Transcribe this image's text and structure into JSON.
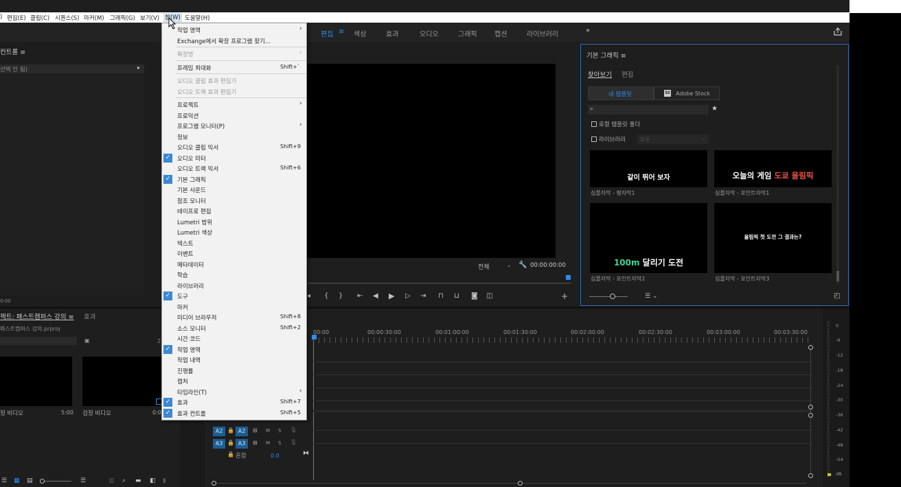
{
  "menubar": {
    "items": [
      "편집(E)",
      "클립(C)",
      "시퀀스(S)",
      "마커(M)",
      "그래픽(G)",
      "보기(V)",
      "창(W)",
      "도움말(H)"
    ]
  },
  "workspaces": {
    "items": [
      "편집",
      "색상",
      "효과",
      "오디오",
      "그래픽",
      "캡션",
      "라이브러리"
    ],
    "current_marker": "≡",
    "more": "»"
  },
  "effect_controls": {
    "title": "컨트롤 ≡",
    "selection": "선택 안 됨)",
    "timecode": "0:00"
  },
  "project": {
    "tab_title": "젝트: 패스트캠퍼스 강의 ≡",
    "tab_effects": "효과",
    "filename": "패스트캠퍼스 강의.prproj",
    "count": "2",
    "items": [
      {
        "name": "정 비디오",
        "duration": "5:00"
      },
      {
        "name": "검정 비디오",
        "duration": "0:0"
      }
    ]
  },
  "window_menu": {
    "items": [
      {
        "label": "작업 영역",
        "arrow": true
      },
      {
        "label": "Exchange에서 확장 프로그램 찾기..."
      },
      {
        "sep": true
      },
      {
        "label": "확장명",
        "disabled": true,
        "arrow": true
      },
      {
        "sep": true
      },
      {
        "label": "프레임 최대화",
        "shortcut": "Shift+`"
      },
      {
        "sep": true
      },
      {
        "label": "오디오 클립 효과 편집기",
        "disabled": true
      },
      {
        "label": "오디오 트랙 효과 편집기",
        "disabled": true
      },
      {
        "sep": true
      },
      {
        "label": "프로젝트",
        "arrow": true
      },
      {
        "label": "프로덕션"
      },
      {
        "label": "프로그램 모니터(P)",
        "arrow": true
      },
      {
        "label": "정보"
      },
      {
        "label": "오디오 클립 믹서",
        "shortcut": "Shift+9"
      },
      {
        "label": "오디오 미터",
        "checked": true
      },
      {
        "label": "오디오 트랙 믹서",
        "shortcut": "Shift+6"
      },
      {
        "label": "기본 그래픽",
        "checked": true
      },
      {
        "label": "기본 사운드"
      },
      {
        "label": "참조 모니터"
      },
      {
        "label": "테이프로 편집"
      },
      {
        "label": "Lumetri 범위"
      },
      {
        "label": "Lumetri 색상"
      },
      {
        "label": "텍스트"
      },
      {
        "label": "이벤트"
      },
      {
        "label": "메타데이터"
      },
      {
        "label": "학습"
      },
      {
        "label": "라이브러리"
      },
      {
        "label": "도구",
        "checked": true
      },
      {
        "label": "마커"
      },
      {
        "label": "미디어 브라우저",
        "shortcut": "Shift+8"
      },
      {
        "label": "소스 모니터",
        "shortcut": "Shift+2"
      },
      {
        "label": "시간 코드"
      },
      {
        "label": "작업 영역",
        "checked": true
      },
      {
        "label": "작업 내역"
      },
      {
        "label": "진행률"
      },
      {
        "label": "캡처"
      },
      {
        "label": "타임라인(T)",
        "arrow": true
      },
      {
        "label": "효과",
        "checked": true,
        "shortcut": "Shift+7"
      },
      {
        "label": "효과 컨트롤",
        "checked": true,
        "shortcut": "Shift+5"
      }
    ]
  },
  "program_monitor": {
    "fit": "전체",
    "timecode": "00:00:00:00"
  },
  "essential_graphics": {
    "title": "기본 그래픽 ≡",
    "tab_browse": "찾아보기",
    "tab_edit": "편집",
    "my_templates": "내 템플릿",
    "stock_label": "Adobe Stock",
    "stock_badge": "St",
    "local_folder": "로컬 템플릿 폴더",
    "libraries": "라이브러리",
    "libraries_select": "모두",
    "templates": [
      {
        "text": "같이 뛰어 보자",
        "caption": "심플자막 - 평자막1"
      },
      {
        "text_a": "오늘의 게임 ",
        "text_b": "도쿄 올림픽",
        "caption": "심플자막 - 포인트자막1"
      },
      {
        "text_a": "100m ",
        "text_b": "달리기 도전",
        "caption": "심플자막 - 포인트자막2"
      },
      {
        "text": "올림픽 첫 도전 그 결과는?",
        "caption": "심플자막 - 포인트자막3"
      }
    ]
  },
  "timeline": {
    "ruler": [
      "00:00",
      "00:00:30:00",
      "00:01:00:00",
      "00:01:30:00",
      "00:02:00:00",
      "00:02:30:00",
      "00:03:00:00",
      "00:03:30:00"
    ],
    "tracks": [
      {
        "src": "A2",
        "dst": "A2",
        "m": "M",
        "s": "S"
      },
      {
        "src": "A3",
        "dst": "A3",
        "m": "M",
        "s": "S"
      }
    ],
    "mix_label": "혼합",
    "mix_value": "0.0"
  },
  "audio_meter": {
    "scale": [
      "0",
      "-6",
      "-12",
      "-18",
      "-24",
      "-30",
      "-36",
      "-42",
      "-48",
      "-54",
      "dB"
    ]
  }
}
